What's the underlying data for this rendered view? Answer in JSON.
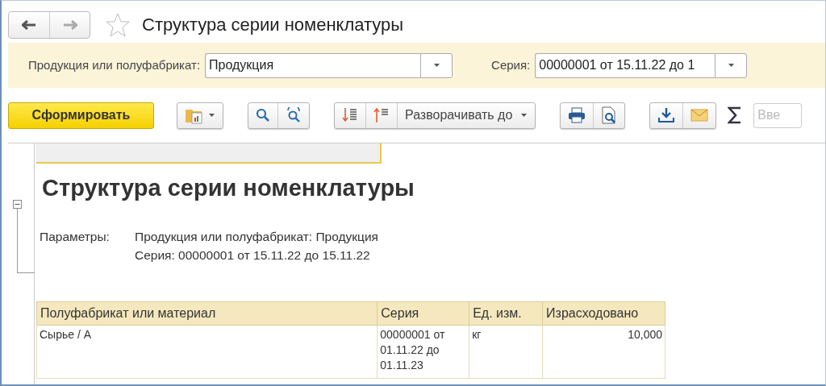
{
  "window": {
    "title": "Структура серии номенклатуры",
    "favorite": false
  },
  "filters": [
    {
      "label": "Продукция или полуфабрикат:",
      "value": "Продукция"
    },
    {
      "label": "Серия:",
      "value": "00000001 от 15.11.22 до 1"
    }
  ],
  "toolbar": {
    "generate_button": "Сформировать",
    "expand_button": "Разворачивать до",
    "search": {
      "placeholder": "Вве"
    }
  },
  "report": {
    "title": "Структура серии номенклатуры",
    "params_label": "Параметры:",
    "params": [
      "Продукция или полуфабрикат: Продукция",
      "Серия: 00000001 от 15.11.22 до 15.11.22"
    ],
    "expanded": true,
    "table": {
      "columns": [
        "Полуфабрикат или материал",
        "Серия",
        "Ед. изм.",
        "Израсходовано"
      ],
      "rows": [
        {
          "cells": [
            "Сырье / А",
            "00000001 от 01.11.22 до 01.11.23",
            "кг",
            "10,000"
          ]
        }
      ]
    }
  }
}
